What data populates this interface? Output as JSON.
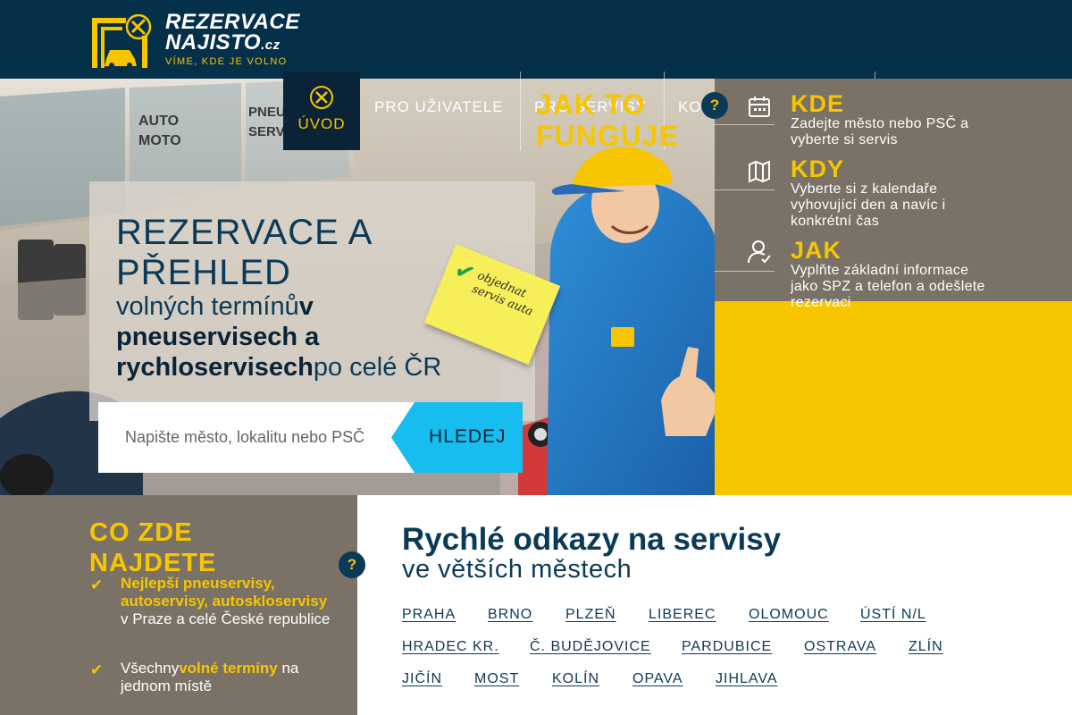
{
  "brand": {
    "name_line1": "REZERVACE",
    "name_line2": "NAJISTO",
    "name_suffix": ".cz",
    "tagline": "VÍME, KDE JE VOLNO",
    "colors": {
      "navy": "#04304a",
      "yellow": "#f7c600",
      "gray": "#7a7266",
      "cyan": "#18bdf0"
    }
  },
  "nav": {
    "items": [
      {
        "label": "ÚVOD",
        "icon": "wrench-screwdriver-icon",
        "active": true
      },
      {
        "label": "PRO UŽIVATELE"
      },
      {
        "label": "PRO SERVISY"
      },
      {
        "label": "KONTAKT A PODPORA"
      }
    ]
  },
  "hero": {
    "title": "REZERVACE A PŘEHLED",
    "sub_1": "volných termínů",
    "sub_2": "v pneuservisech a rychloservisech",
    "sub_3": "po celé ČR",
    "note_text": "objednat\nservis auta",
    "search": {
      "placeholder": "Napište město, lokalitu nebo PSČ",
      "button": "HLEDEJ"
    }
  },
  "how": {
    "title": "JAK TO FUNGUJE",
    "help_icon": "question-icon",
    "steps": [
      {
        "head": "KDE",
        "icon": "calendar-icon",
        "text": "Zadejte město nebo PSČ a vyberte si servis"
      },
      {
        "head": "KDY",
        "icon": "map-icon",
        "text": "Vyberte si z kalendaře vyhovující den a navíc i konkrétní čas"
      },
      {
        "head": "JAK",
        "icon": "user-check-icon",
        "text": "Vyplňte základní informace jako SPZ a telefon a odešlete rezervaci"
      }
    ]
  },
  "features": {
    "title": "CO ZDE NAJDETE",
    "items": [
      {
        "highlight": "Nejlepší pneuservisy, autoservisy, autoskloservisy",
        "rest": " v Praze a celé České republice"
      },
      {
        "prefix": "Všechny",
        "highlight": "volné termíny",
        "rest": " na jednom místě"
      }
    ]
  },
  "links": {
    "title": "Rychlé odkazy na servisy",
    "subtitle": "ve větších městech",
    "cities": [
      "PRAHA",
      "BRNO",
      "PLZEŇ",
      "LIBEREC",
      "OLOMOUC",
      "ÚSTÍ N/L",
      "HRADEC KR.",
      "Č. BUDĚJOVICE",
      "PARDUBICE",
      "OSTRAVA",
      "ZLÍN",
      "JIČÍN",
      "MOST",
      "KOLÍN",
      "OPAVA",
      "JIHLAVA"
    ]
  }
}
